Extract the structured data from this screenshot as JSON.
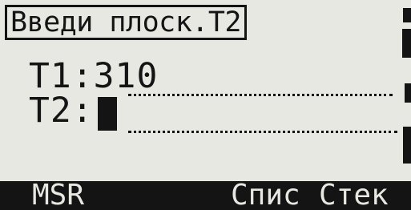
{
  "title": "Введи плоск.T2",
  "fields": {
    "t1": {
      "label": "T1:",
      "value": "310"
    },
    "t2": {
      "label": "T2:",
      "value": ""
    }
  },
  "softkeys": {
    "msr": "MSR",
    "list": "Спис",
    "stack": "Стек"
  },
  "colors": {
    "background": "#e6e8e1",
    "foreground": "#141414"
  }
}
